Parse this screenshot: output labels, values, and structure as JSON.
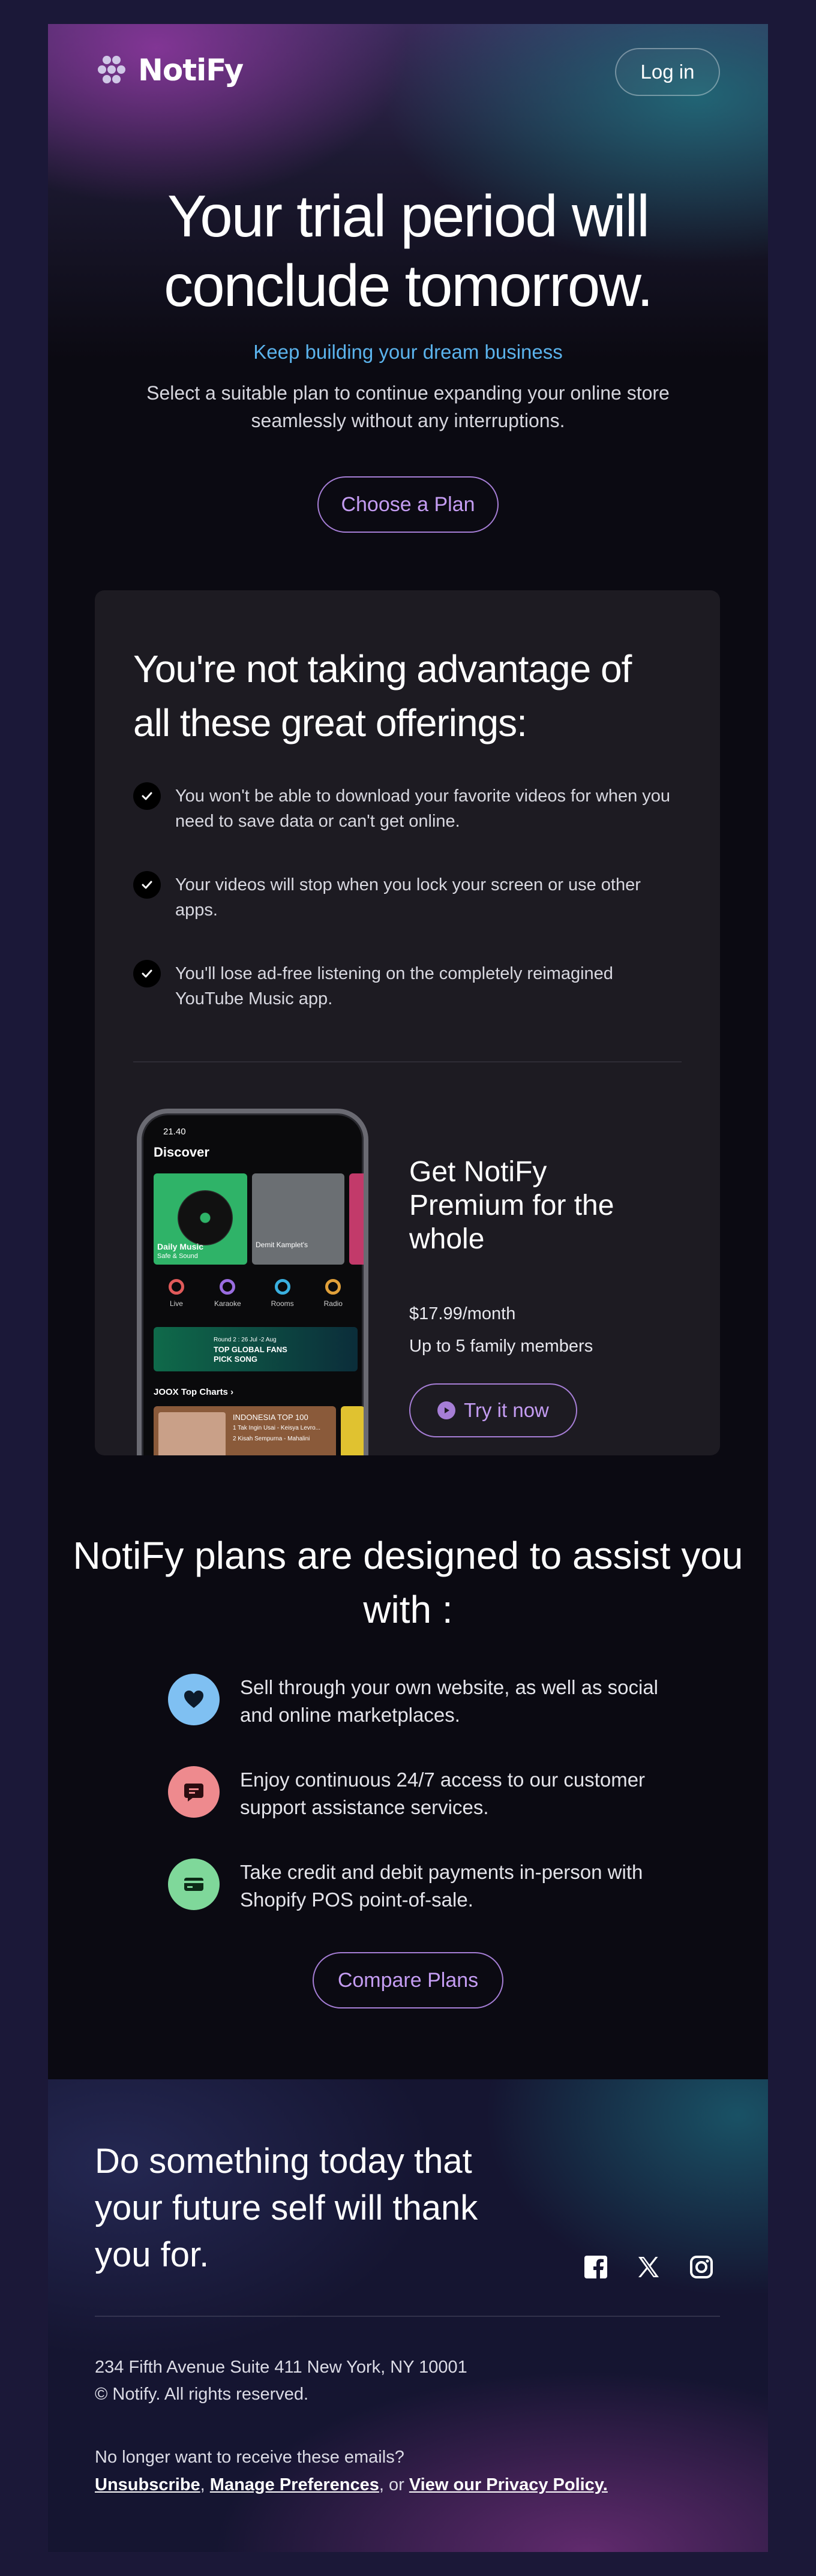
{
  "header": {
    "brand": "NotiFy",
    "login_label": "Log in"
  },
  "hero": {
    "title_line1": "Your trial period will",
    "title_line2": "conclude tomorrow.",
    "subtitle": "Keep building your dream business",
    "description": "Select a suitable plan to continue expanding your online store seamlessly without any interruptions.",
    "cta_label": "Choose a Plan"
  },
  "offerings": {
    "title": "You're not taking advantage of all these great offerings:",
    "items": [
      {
        "text": "You won't be able to download your favorite videos for when you need to save data or can't get online."
      },
      {
        "text": "Your videos will stop when you lock your screen or use other apps."
      },
      {
        "text": "You'll lose ad-free listening on the completely reimagined YouTube Music app."
      }
    ]
  },
  "phone": {
    "time": "21.40",
    "heading": "Discover",
    "tile1_title": "Daily Music",
    "tile1_sub": "Safe & Sound",
    "tile2_title": "Demit  Kamplet's",
    "categories": [
      "Live",
      "Karaoke",
      "Rooms",
      "Radio"
    ],
    "banner_line1": "Round 2 : 26 Jul -2 Aug",
    "banner_line2": "TOP GLOBAL FANS",
    "banner_line3": "PICK SONG",
    "charts_label": "JOOX Top Charts  ›",
    "chart_title": "INDONESIA TOP 100",
    "chart_item1": "1 Tak Ingin Usai - Keisya Levro...",
    "chart_item2": "2 Kisah Sempurna - Mahalini"
  },
  "premium": {
    "title": "Get NotiFy Premium for the whole",
    "price": "$17.99/month",
    "members": "Up to 5 family members",
    "cta_label": "Try it now"
  },
  "plans": {
    "title": "NotiFy plans are designed to assist you with :",
    "features": [
      {
        "text": "Sell through your own website, as well as social and online marketplaces.",
        "icon": "heart-icon",
        "color": "#7fc0f2"
      },
      {
        "text": "Enjoy continuous 24/7 access to our customer support assistance services.",
        "icon": "chat-icon",
        "color": "#ee8a8e"
      },
      {
        "text": "Take credit and debit payments in-person with Shopify POS point-of-sale.",
        "icon": "credit-card-icon",
        "color": "#7fd89a"
      }
    ],
    "cta_label": "Compare Plans"
  },
  "footer": {
    "title": "Do something today that your future self will thank you for.",
    "socials": [
      "facebook-icon",
      "x-icon",
      "instagram-icon"
    ],
    "address": "234 Fifth Avenue Suite 411 New York, NY 10001",
    "copyright": "© Notify. All rights reserved.",
    "unsubscribe_question": "No longer want to receive these emails?",
    "link_unsubscribe": "Unsubscribe",
    "link_preferences": "Manage Preferences",
    "link_or": ", or ",
    "link_privacy": "View our Privacy Policy."
  },
  "colors": {
    "accent": "#a67ed6",
    "subtitle": "#5bb3ec",
    "background": "#0b0a12"
  }
}
